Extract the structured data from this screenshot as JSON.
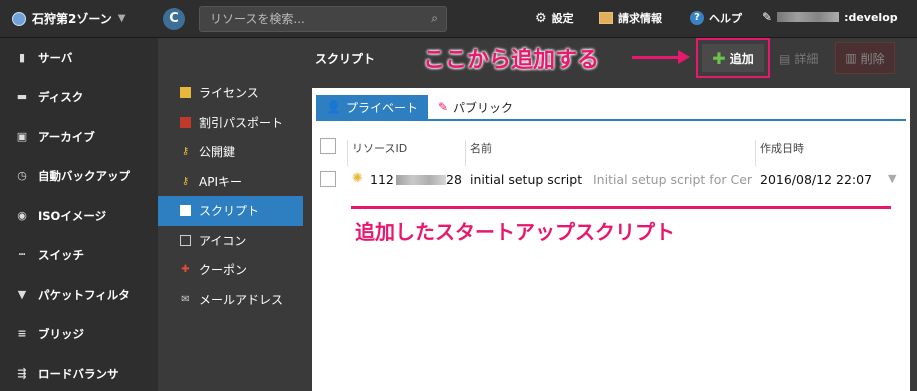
{
  "topbar": {
    "zone": "石狩第2ゾーン",
    "search_placeholder": "リソースを検索...",
    "settings": "設定",
    "billing": "請求情報",
    "help": "ヘルプ",
    "account_suffix": ":develop"
  },
  "sidebar": {
    "items": [
      {
        "label": "サーバ",
        "icon": "server-icon"
      },
      {
        "label": "ディスク",
        "icon": "disk-icon"
      },
      {
        "label": "アーカイブ",
        "icon": "archive-icon"
      },
      {
        "label": "自動バックアップ",
        "icon": "clock-icon"
      },
      {
        "label": "ISOイメージ",
        "icon": "disc-icon"
      },
      {
        "label": "スイッチ",
        "icon": "switch-icon"
      },
      {
        "label": "パケットフィルタ",
        "icon": "filter-icon"
      },
      {
        "label": "ブリッジ",
        "icon": "bridge-icon"
      },
      {
        "label": "ロードバランサ",
        "icon": "loadbalancer-icon"
      }
    ]
  },
  "subnav": {
    "items": [
      {
        "label": "ライセンス",
        "icon": "license-icon"
      },
      {
        "label": "割引パスポート",
        "icon": "passport-icon"
      },
      {
        "label": "公開鍵",
        "icon": "key-icon"
      },
      {
        "label": "APIキー",
        "icon": "apikey-icon"
      },
      {
        "label": "スクリプト",
        "icon": "script-icon",
        "active": true
      },
      {
        "label": "アイコン",
        "icon": "image-icon"
      },
      {
        "label": "クーポン",
        "icon": "gift-icon"
      },
      {
        "label": "メールアドレス",
        "icon": "mail-icon"
      }
    ]
  },
  "main": {
    "title": "スクリプト",
    "callout_add": "ここから追加する",
    "add_button": "追加",
    "detail_button": "詳細",
    "delete_button": "削除",
    "tabs": [
      {
        "label": "プライベート",
        "active": true
      },
      {
        "label": "パブリック",
        "active": false
      }
    ],
    "table": {
      "headers": [
        "リソースID",
        "名前",
        "作成日時"
      ],
      "rows": [
        {
          "id_prefix": "112",
          "id_suffix": "28",
          "name": "initial setup script",
          "description": "Initial setup script for Cer",
          "created": "2016/08/12 22:07"
        }
      ]
    },
    "callout_added": "追加したスタートアップスクリプト"
  },
  "colors": {
    "accent": "#2d7fc1",
    "annotation": "#e8186d",
    "add_plus": "#6cc24a"
  }
}
